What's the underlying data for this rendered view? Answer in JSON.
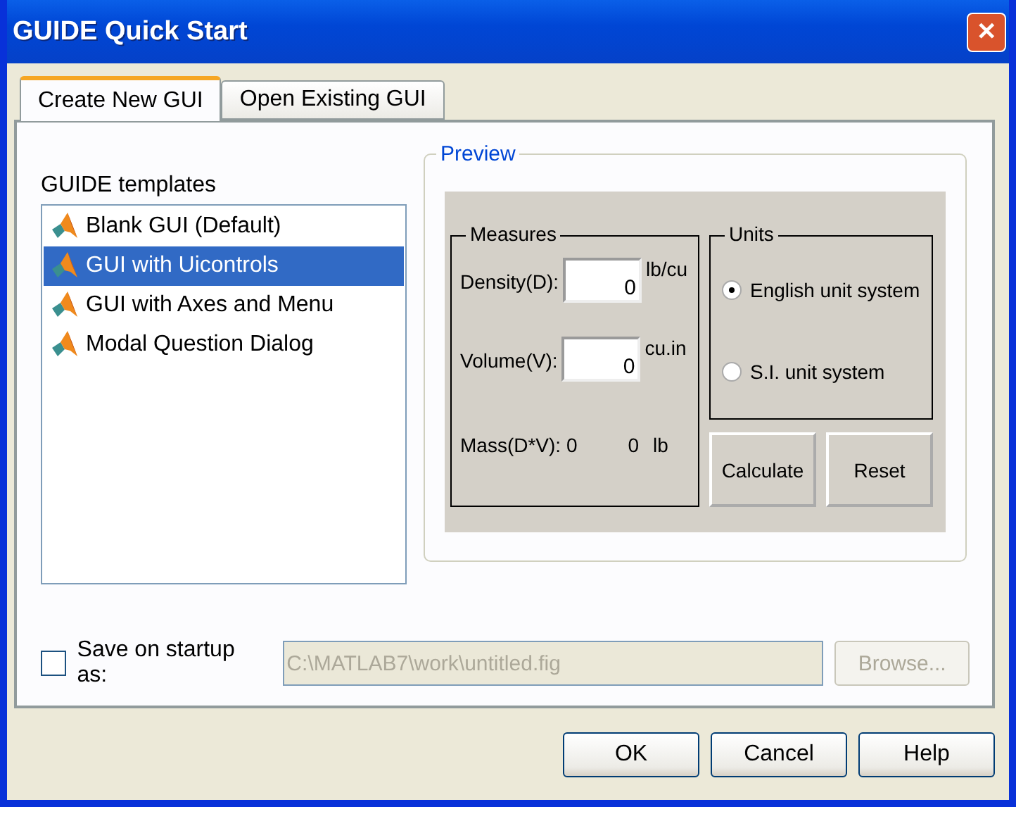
{
  "window": {
    "title": "GUIDE Quick Start",
    "close": "✕"
  },
  "tabs": [
    {
      "label": "Create New GUI",
      "selected": true
    },
    {
      "label": "Open Existing GUI",
      "selected": false
    }
  ],
  "templates": {
    "label": "GUIDE templates",
    "items": [
      {
        "label": "Blank GUI (Default)",
        "selected": false
      },
      {
        "label": "GUI with Uicontrols",
        "selected": true
      },
      {
        "label": "GUI with Axes and Menu",
        "selected": false
      },
      {
        "label": "Modal Question Dialog",
        "selected": false
      }
    ]
  },
  "preview": {
    "title": "Preview",
    "measures": {
      "title": "Measures",
      "fields": [
        {
          "label": "Density(D):",
          "value": "0",
          "unit": "lb/cu"
        },
        {
          "label": "Volume(V):",
          "value": "0",
          "unit": "cu.in"
        }
      ],
      "mass": {
        "label": "Mass(D*V): 0",
        "value": "0",
        "unit": "lb"
      }
    },
    "units": {
      "title": "Units",
      "options": [
        {
          "label": "English unit system",
          "selected": true
        },
        {
          "label": "S.I. unit system",
          "selected": false
        }
      ]
    },
    "buttons": [
      "Calculate",
      "Reset"
    ]
  },
  "save": {
    "label": "Save on startup as:",
    "checked": false,
    "value": "C:\\MATLAB7\\work\\untitled.fig",
    "browse": "Browse...",
    "disabled": true
  },
  "buttons": [
    "OK",
    "Cancel",
    "Help"
  ]
}
